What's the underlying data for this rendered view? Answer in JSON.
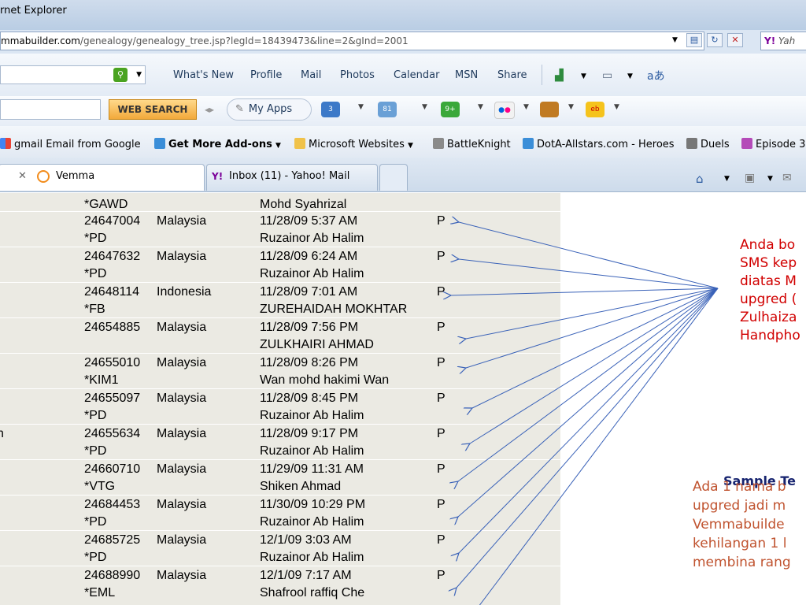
{
  "window": {
    "title": "rnet Explorer"
  },
  "address": {
    "host": "mmabuilder.com",
    "path": "/genealogy/genealogy_tree.jsp?legId=18439473&line=2&gInd=2001",
    "search_provider": "Yah"
  },
  "msn_toolbar": {
    "items": [
      "What's New",
      "Profile",
      "Mail",
      "Photos",
      "Calendar",
      "MSN",
      "Share"
    ]
  },
  "apps_toolbar": {
    "web_search_label": "WEB SEARCH",
    "my_apps_label": "My Apps",
    "badges": [
      "3",
      "81",
      "9+"
    ]
  },
  "favorites": [
    "gmail Email from Google",
    "Get More Add-ons",
    "Microsoft Websites",
    "BattleKnight",
    "DotA-Allstars.com - Heroes",
    "Duels",
    "Episode 3"
  ],
  "tabs": [
    {
      "label": "Vemma"
    },
    {
      "label": "Inbox (11) - Yahoo! Mail"
    }
  ],
  "table": {
    "first_row": {
      "code": "*GAWD",
      "name": "Mohd Syahrizal"
    },
    "rows": [
      {
        "id": "24647004",
        "country": "Malaysia",
        "date": "11/28/09 5:37 AM",
        "status": "P",
        "code": "*PD",
        "name": "Ruzainor Ab Halim"
      },
      {
        "id": "24647632",
        "country": "Malaysia",
        "date": "11/28/09 6:24 AM",
        "status": "P",
        "code": "*PD",
        "name": "Ruzainor Ab Halim"
      },
      {
        "id": "24648114",
        "country": "Indonesia",
        "date": "11/28/09 7:01 AM",
        "status": "P",
        "code": "*FB",
        "name": "ZUREHAIDAH MOKHTAR"
      },
      {
        "id": "24654885",
        "country": "Malaysia",
        "date": "11/28/09 7:56 PM",
        "status": "P",
        "code": "",
        "name": "ZULKHAIRI AHMAD"
      },
      {
        "id": "24655010",
        "country": "Malaysia",
        "date": "11/28/09 8:26 PM",
        "status": "P",
        "code": "*KIM1",
        "name": "Wan mohd hakimi Wan"
      },
      {
        "id": "24655097",
        "country": "Malaysia",
        "date": "11/28/09 8:45 PM",
        "status": "P",
        "code": "*PD",
        "name": "Ruzainor Ab Halim"
      },
      {
        "id": "24655634",
        "country": "Malaysia",
        "date": "11/28/09 9:17 PM",
        "status": "P",
        "code": "*PD",
        "name": "Ruzainor Ab Halim",
        "left_edge": "n"
      },
      {
        "id": "24660710",
        "country": "Malaysia",
        "date": "11/29/09 11:31 AM",
        "status": "P",
        "code": "*VTG",
        "name": "Shiken Ahmad"
      },
      {
        "id": "24684453",
        "country": "Malaysia",
        "date": "11/30/09 10:29 PM",
        "status": "P",
        "code": "*PD",
        "name": "Ruzainor Ab Halim"
      },
      {
        "id": "24685725",
        "country": "Malaysia",
        "date": "12/1/09 3:03 AM",
        "status": "P",
        "code": "*PD",
        "name": "Ruzainor Ab Halim"
      },
      {
        "id": "24688990",
        "country": "Malaysia",
        "date": "12/1/09 7:17 AM",
        "status": "P",
        "code": "*EML",
        "name": "Shafrool raffiq Che"
      }
    ]
  },
  "annotation": {
    "red_lines": [
      "Anda bo",
      "SMS kep",
      "diatas M",
      "upgred (",
      "Zulhaiza",
      "Handpho"
    ],
    "sample_heading": "Sample Te",
    "sample_lines": [
      "Ada 1 nama b",
      "upgred jadi m",
      "Vemmabuilde",
      "kehilangan 1 l",
      "membina rang"
    ],
    "colors": {
      "red": "#d10000",
      "heading": "#16236f",
      "sample": "#c0532f",
      "arrow": "#3a62b8"
    }
  }
}
